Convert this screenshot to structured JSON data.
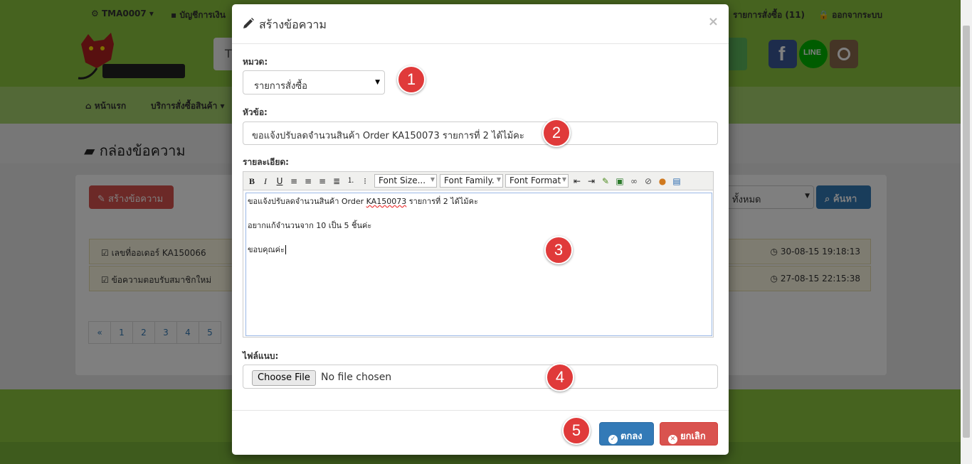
{
  "background": {
    "topbar": {
      "user": "TMA0007",
      "account": "บัญชีการเงิน",
      "orders": "รายการสั่งซื้อ (11)",
      "logout": "ออกจากระบบ"
    },
    "search_placeholder_fragment": "T",
    "social": [
      "facebook-icon",
      "line-icon",
      "instagram-icon"
    ],
    "social_line_text": "LINE",
    "nav": {
      "home": "หน้าแรก",
      "services": "บริการสั่งซื้อสินค้า"
    },
    "page_title": "กล่องข้อความ",
    "create_button": "สร้างข้อความ",
    "filter_value": "ทั้งหมด",
    "search_button": "ค้นหา",
    "messages": [
      {
        "subject": "เลขที่ออเดอร์ KA150066",
        "time": "30-08-15 19:18:13"
      },
      {
        "subject": "ข้อความตอบรับสมาชิกใหม่",
        "time": "27-08-15 22:15:38"
      }
    ],
    "pager": [
      "«",
      "1",
      "2",
      "3",
      "4",
      "5"
    ]
  },
  "modal": {
    "title": "สร้างข้อความ",
    "close": "×",
    "category_label": "หมวด:",
    "category_value": "รายการสั่งซื้อ",
    "subject_label": "หัวข้อ:",
    "subject_value": "ขอแจ้งปรับลดจำนวนสินค้า Order KA150073 รายการที่ 2 ได้ไม้คะ",
    "detail_label": "รายละเอียด:",
    "toolbar": {
      "font_size": "Font Size...",
      "font_family": "Font Family.",
      "font_format": "Font Format"
    },
    "editor_lines": [
      "ขอแจ้งปรับลดจำนวนสินค้า Order ",
      "KA150073",
      " รายการที่ 2 ได้ไม้คะ",
      "อยากแก้จำนวนจาก 10 เป็น 5 ชิ้นค่ะ",
      "ขอบคุณค่ะ"
    ],
    "attachment_label": "ไฟล์แนบ:",
    "choose_file": "Choose File",
    "no_file": "No file chosen",
    "ok_button": "ตกลง",
    "cancel_button": "ยกเลิก"
  },
  "markers": [
    "1",
    "2",
    "3",
    "4",
    "5"
  ],
  "colors": {
    "brand_green": "#8dc63f",
    "primary": "#337ab7",
    "danger": "#d9534f",
    "marker": "#e03a3a"
  }
}
